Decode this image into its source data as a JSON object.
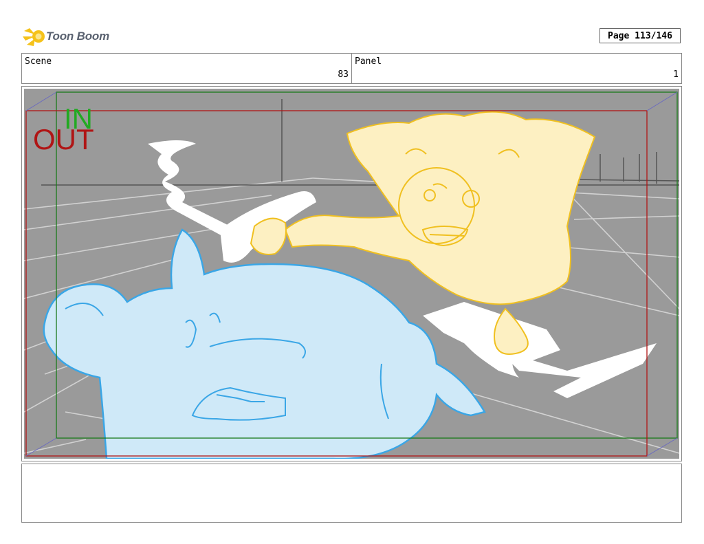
{
  "header": {
    "logo_text": "Toon Boom",
    "page_label": "Page 113/146"
  },
  "info": {
    "scene_label": "Scene",
    "scene_value": "83",
    "panel_label": "Panel",
    "panel_value": "1"
  },
  "panel": {
    "in_label": "IN",
    "out_label": "OUT",
    "colors": {
      "background": "#9a9a9a",
      "in_frame": "#1a7a1a",
      "out_frame": "#b01515",
      "dog_fill": "#cfe9f8",
      "dog_line": "#3aa6e6",
      "lion_fill": "#fdf0c2",
      "lion_line": "#f0c020"
    },
    "icons": [
      "toon-boom-logo-icon"
    ]
  },
  "notes": {
    "text": ""
  }
}
